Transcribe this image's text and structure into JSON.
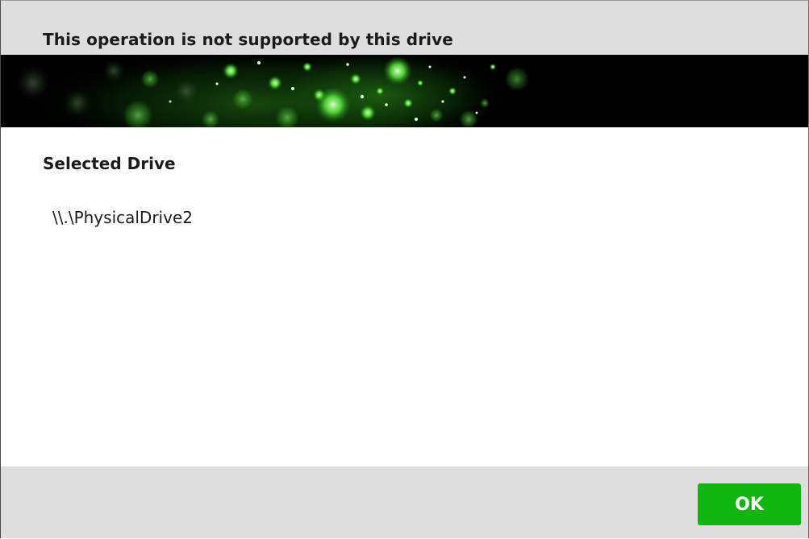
{
  "dialog": {
    "title": "This operation is not supported by this drive",
    "section_label": "Selected Drive",
    "drive_path": "\\\\.\\PhysicalDrive2",
    "ok_label": "OK"
  },
  "colors": {
    "header_bg": "#dedede",
    "banner_bg": "#000000",
    "banner_glow": "#3bd42a",
    "ok_button": "#10b60f"
  },
  "icons": {
    "banner": "green-bokeh-banner"
  }
}
